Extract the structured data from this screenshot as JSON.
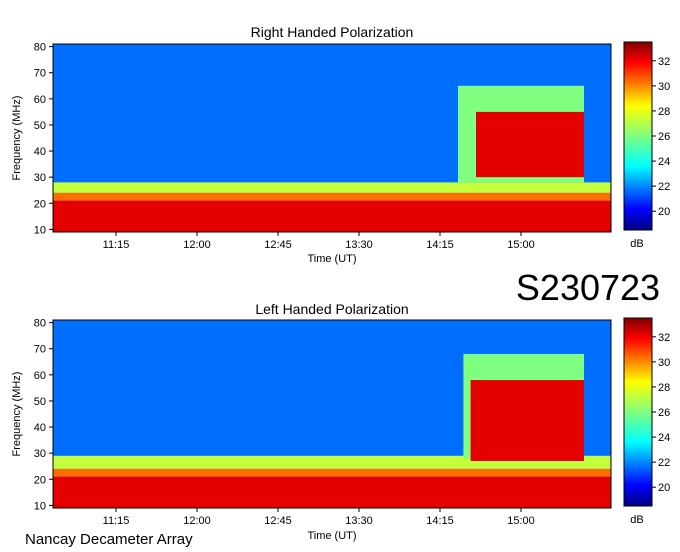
{
  "figure_id": "S230723",
  "footer": "Nancay Decameter Array",
  "colors": {
    "nightly_background": "#ffffff",
    "scale_low": "#00007f",
    "scale_high": "#7f0000"
  },
  "chart_data": [
    {
      "type": "heatmap",
      "title": "Right Handed Polarization",
      "xlabel": "Time (UT)",
      "ylabel": "Frequency (MHz)",
      "x_tick_labels": [
        "11:15",
        "12:00",
        "12:45",
        "13:30",
        "14:15",
        "15:00"
      ],
      "y_ticks": [
        10,
        20,
        30,
        40,
        50,
        60,
        70,
        80
      ],
      "ylim": [
        9,
        81
      ],
      "colorbar": {
        "label": "dB",
        "ticks": [
          20,
          22,
          24,
          26,
          28,
          30,
          32
        ],
        "range": [
          18.5,
          33.5
        ]
      },
      "features": [
        {
          "kind": "background",
          "level": 22
        },
        {
          "kind": "band",
          "y_range": [
            9,
            21
          ],
          "level": 32
        },
        {
          "kind": "band",
          "y_range": [
            21,
            24
          ],
          "level": 30
        },
        {
          "kind": "band",
          "y_range": [
            24,
            28
          ],
          "level": 27
        },
        {
          "kind": "emission",
          "x_range": [
            "14:25",
            "15:35"
          ],
          "y_range": [
            28,
            65
          ],
          "level": 26
        },
        {
          "kind": "emission",
          "x_range": [
            "14:35",
            "15:35"
          ],
          "y_range": [
            30,
            55
          ],
          "level": 32
        }
      ]
    },
    {
      "type": "heatmap",
      "title": "Left Handed Polarization",
      "xlabel": "Time (UT)",
      "ylabel": "Frequency (MHz)",
      "x_tick_labels": [
        "11:15",
        "12:00",
        "12:45",
        "13:30",
        "14:15",
        "15:00"
      ],
      "y_ticks": [
        10,
        20,
        30,
        40,
        50,
        60,
        70,
        80
      ],
      "ylim": [
        9,
        81
      ],
      "colorbar": {
        "label": "dB",
        "ticks": [
          20,
          22,
          24,
          26,
          28,
          30,
          32
        ],
        "range": [
          18.5,
          33.5
        ]
      },
      "features": [
        {
          "kind": "background",
          "level": 22
        },
        {
          "kind": "band",
          "y_range": [
            9,
            21
          ],
          "level": 32
        },
        {
          "kind": "band",
          "y_range": [
            21,
            24
          ],
          "level": 30
        },
        {
          "kind": "band",
          "y_range": [
            24,
            29
          ],
          "level": 27
        },
        {
          "kind": "emission",
          "x_range": [
            "14:28",
            "15:35"
          ],
          "y_range": [
            28,
            68
          ],
          "level": 26
        },
        {
          "kind": "emission",
          "x_range": [
            "14:32",
            "15:35"
          ],
          "y_range": [
            27,
            58
          ],
          "level": 32
        }
      ]
    }
  ]
}
